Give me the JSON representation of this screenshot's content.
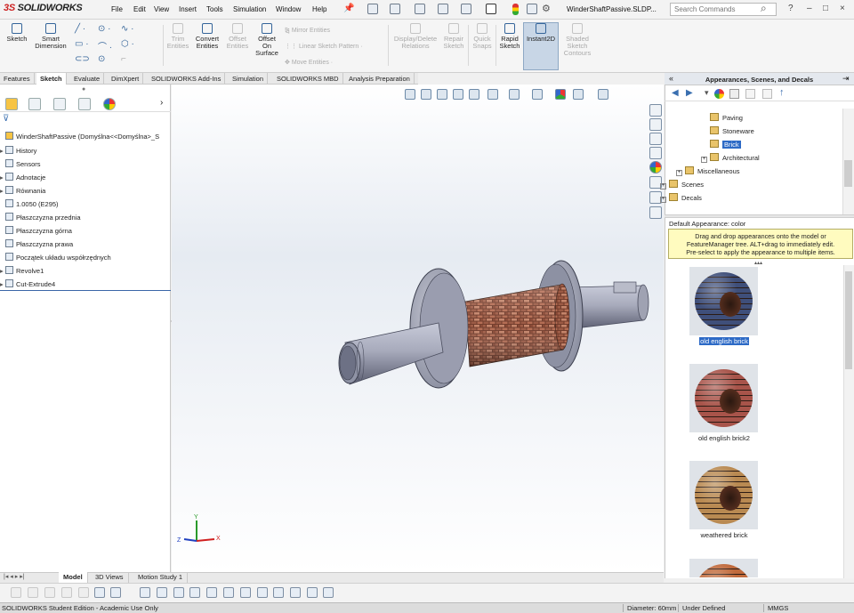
{
  "app": {
    "logo_prefix": "3S",
    "logo_name": "SOLIDWORKS",
    "document_title": "WinderShaftPassive.SLDP...",
    "search_placeholder": "Search Commands"
  },
  "menu": [
    "File",
    "Edit",
    "View",
    "Insert",
    "Tools",
    "Simulation",
    "Window",
    "Help"
  ],
  "window_buttons": [
    "?",
    "–",
    "□",
    "×"
  ],
  "commands": {
    "sketch": "Sketch",
    "smart_dimension": [
      "Smart",
      "Dimension"
    ],
    "trim": [
      "Trim",
      "Entities"
    ],
    "convert": [
      "Convert",
      "Entities"
    ],
    "offset": [
      "Offset",
      "Entities"
    ],
    "offset_surface": [
      "Offset",
      "On",
      "Surface"
    ],
    "mirror": "Mirror Entities",
    "linear_pattern": "Linear Sketch Pattern",
    "move": "Move Entities",
    "display_delete": [
      "Display/Delete",
      "Relations"
    ],
    "repair": [
      "Repair",
      "Sketch"
    ],
    "quick_snaps": [
      "Quick",
      "Snaps"
    ],
    "rapid_sketch": [
      "Rapid",
      "Sketch"
    ],
    "instant2d": "Instant2D",
    "shaded_contours": [
      "Shaded",
      "Sketch",
      "Contours"
    ]
  },
  "tabs": [
    "Features",
    "Sketch",
    "Evaluate",
    "DimXpert",
    "SOLIDWORKS Add-Ins",
    "Simulation",
    "SOLIDWORKS MBD",
    "Analysis Preparation"
  ],
  "active_tab": "Sketch",
  "feature_tree": {
    "root": "WinderShaftPassive  (Domyślna<<Domyślna>_S",
    "items": [
      {
        "label": "History",
        "expand": "▸"
      },
      {
        "label": "Sensors",
        "expand": ""
      },
      {
        "label": "Adnotacje",
        "expand": "▸"
      },
      {
        "label": "Równania",
        "expand": "▸"
      },
      {
        "label": "1.0050 (E295)",
        "expand": ""
      },
      {
        "label": "Płaszczyzna przednia",
        "expand": ""
      },
      {
        "label": "Płaszczyzna górna",
        "expand": ""
      },
      {
        "label": "Płaszczyzna prawa",
        "expand": ""
      },
      {
        "label": "Początek układu współrzędnych",
        "expand": ""
      },
      {
        "label": "Revolve1",
        "expand": "▸"
      },
      {
        "label": "Cut-Extrude4",
        "expand": "▸"
      }
    ]
  },
  "triad": {
    "y": "Y",
    "x": "X",
    "z": "Z"
  },
  "right_panel": {
    "title": "Appearances, Scenes, and Decals",
    "tree": [
      {
        "label": "Paving",
        "level": 2,
        "pm": ""
      },
      {
        "label": "Stoneware",
        "level": 2,
        "pm": ""
      },
      {
        "label": "Brick",
        "level": 2,
        "pm": "",
        "selected": true
      },
      {
        "label": "Architectural",
        "level": 2,
        "pm": "+"
      },
      {
        "label": "Miscellaneous",
        "level": 1,
        "pm": "+"
      },
      {
        "label": "Scenes",
        "level": 0,
        "pm": "+"
      },
      {
        "label": "Decals",
        "level": 0,
        "pm": "+"
      }
    ],
    "default_appearance": "Default Appearance: color",
    "tip": [
      "Drag and drop appearances onto the model or",
      "FeatureManager tree.  ALT+drag to immediately edit.",
      "Pre-select to apply the appearance to multiple items."
    ],
    "swatches": [
      {
        "name": "old english brick",
        "color": "#3f4f7a"
      },
      {
        "name": "old english brick2",
        "color": "#a8544a"
      },
      {
        "name": "weathered brick",
        "color": "#b98a52"
      },
      {
        "name": "",
        "color": "#c06a3c"
      }
    ]
  },
  "bottom_tabs": [
    "Model",
    "3D Views",
    "Motion Study 1"
  ],
  "active_bottom_tab": "Model",
  "status": {
    "left": "SOLIDWORKS Student Edition - Academic Use Only",
    "diameter": "Diameter: 60mm",
    "defined": "Under Defined",
    "units": "MMGS"
  }
}
